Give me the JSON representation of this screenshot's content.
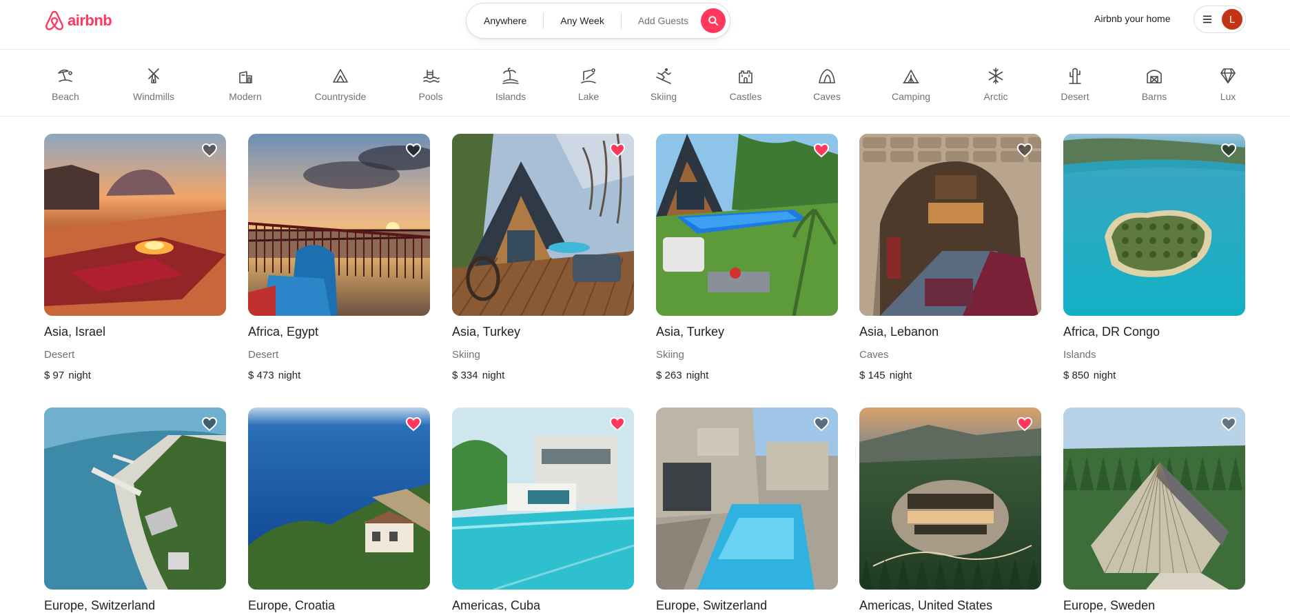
{
  "brand": {
    "name": "airbnb",
    "color": "#ff385c"
  },
  "search": {
    "where": "Anywhere",
    "when": "Any Week",
    "guests": "Add Guests",
    "button_icon": "search-icon"
  },
  "header": {
    "host_link": "Airbnb your home",
    "menu_icon": "hamburger-icon",
    "avatar_initial": "L"
  },
  "categories": [
    {
      "label": "Beach",
      "icon": "beach-icon"
    },
    {
      "label": "Windmills",
      "icon": "windmill-icon"
    },
    {
      "label": "Modern",
      "icon": "modern-house-icon"
    },
    {
      "label": "Countryside",
      "icon": "countryside-icon"
    },
    {
      "label": "Pools",
      "icon": "pool-icon"
    },
    {
      "label": "Islands",
      "icon": "island-icon"
    },
    {
      "label": "Lake",
      "icon": "lake-icon"
    },
    {
      "label": "Skiing",
      "icon": "skiing-icon"
    },
    {
      "label": "Castles",
      "icon": "castle-icon"
    },
    {
      "label": "Caves",
      "icon": "cave-icon"
    },
    {
      "label": "Camping",
      "icon": "camping-icon"
    },
    {
      "label": "Arctic",
      "icon": "snowflake-icon"
    },
    {
      "label": "Desert",
      "icon": "cactus-icon"
    },
    {
      "label": "Barns",
      "icon": "barn-icon"
    },
    {
      "label": "Lux",
      "icon": "diamond-icon"
    }
  ],
  "listings": [
    {
      "location": "Asia, Israel",
      "category": "Desert",
      "price": "$ 97",
      "unit": "night",
      "favorite": false,
      "scene": "desert"
    },
    {
      "location": "Africa, Egypt",
      "category": "Desert",
      "price": "$ 473",
      "unit": "night",
      "favorite": false,
      "scene": "sunset"
    },
    {
      "location": "Asia, Turkey",
      "category": "Skiing",
      "price": "$ 334",
      "unit": "night",
      "favorite": true,
      "scene": "aframe"
    },
    {
      "location": "Asia, Turkey",
      "category": "Skiing",
      "price": "$ 263",
      "unit": "night",
      "favorite": true,
      "scene": "poolcabin"
    },
    {
      "location": "Asia, Lebanon",
      "category": "Caves",
      "price": "$ 145",
      "unit": "night",
      "favorite": false,
      "scene": "cave"
    },
    {
      "location": "Africa, DR Congo",
      "category": "Islands",
      "price": "$ 850",
      "unit": "night",
      "favorite": false,
      "scene": "island"
    },
    {
      "location": "Europe, Switzerland",
      "category": "",
      "price": "",
      "unit": "",
      "favorite": false,
      "scene": "coast"
    },
    {
      "location": "Europe, Croatia",
      "category": "",
      "price": "",
      "unit": "",
      "favorite": true,
      "scene": "sea"
    },
    {
      "location": "Americas, Cuba",
      "category": "",
      "price": "",
      "unit": "",
      "favorite": true,
      "scene": "villa"
    },
    {
      "location": "Europe, Switzerland",
      "category": "",
      "price": "",
      "unit": "",
      "favorite": false,
      "scene": "stonepool"
    },
    {
      "location": "Americas, United States",
      "category": "",
      "price": "",
      "unit": "",
      "favorite": true,
      "scene": "forest"
    },
    {
      "location": "Europe, Sweden",
      "category": "",
      "price": "",
      "unit": "",
      "favorite": false,
      "scene": "glasshouse"
    }
  ]
}
